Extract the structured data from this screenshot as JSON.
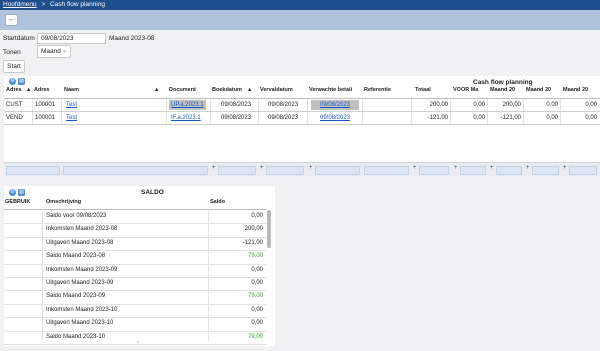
{
  "breadcrumb": {
    "home": "Hoofdmenu",
    "separator": ">",
    "current": "Cash flow planning"
  },
  "icons": {
    "back": "back-arrow-icon",
    "settings": "gear-icon",
    "export": "export-icon",
    "sort": "sort-arrow-icon"
  },
  "form": {
    "start_label": "Startdatum",
    "start_value": "09/08/2023",
    "period_text": "Maand 2023-08",
    "show_label": "Tonen",
    "show_value": "Maand",
    "start_button": "Start"
  },
  "cashflow": {
    "title": "Cash flow planning",
    "columns": [
      "Adres",
      "Adres",
      "Naam",
      "Document",
      "Boekdatum",
      "Vervaldatum",
      "Verwachte betali",
      "Referentie",
      "Totaal",
      "VOOR Ma",
      "Maand 20",
      "Maand 20",
      "Maand 20"
    ],
    "rows": [
      {
        "type": "CUST",
        "adres": "100001",
        "naam": "Test",
        "document": "UP.a.2023.1",
        "boekdatum": "09/08/2023",
        "vervaldatum": "09/08/2023",
        "verwacht": "09/08/2023",
        "referentie": "",
        "totaal": "200,00",
        "voor": "0,00",
        "m1": "200,00",
        "m2": "0,00",
        "m3": "0,00"
      },
      {
        "type": "VEND",
        "adres": "100001",
        "naam": "Test",
        "document": "IF.a.2023.1",
        "boekdatum": "09/08/2023",
        "vervaldatum": "09/08/2023",
        "verwacht": "09/08/2023",
        "referentie": "",
        "totaal": "-121,00",
        "voor": "0,00",
        "m1": "-121,00",
        "m2": "0,00",
        "m3": "0,00"
      }
    ]
  },
  "saldo": {
    "title": "SALDO",
    "columns": {
      "gebruik": "GEBRUIK",
      "omschrijving": "Omschrijving",
      "saldo": "Saldo"
    },
    "rows": [
      {
        "omschrijving": "Saldo voor 09/08/2023",
        "saldo": "0,00",
        "green": false
      },
      {
        "omschrijving": "Inkomsten Maand 2023-08",
        "saldo": "200,00",
        "green": false
      },
      {
        "omschrijving": "Uitgaven Maand 2023-08",
        "saldo": "-121,00",
        "green": false
      },
      {
        "omschrijving": "Saldo Maand 2023-08",
        "saldo": "79,00",
        "green": true
      },
      {
        "omschrijving": "Inkomsten Maand 2023-09",
        "saldo": "0,00",
        "green": false
      },
      {
        "omschrijving": "Uitgaven Maand 2023-09",
        "saldo": "0,00",
        "green": false
      },
      {
        "omschrijving": "Saldo Maand 2023-09",
        "saldo": "79,00",
        "green": true
      },
      {
        "omschrijving": "Inkomsten Maand 2023-10",
        "saldo": "0,00",
        "green": false
      },
      {
        "omschrijving": "Uitgaven Maand 2023-10",
        "saldo": "0,00",
        "green": false
      },
      {
        "omschrijving": "Saldo Maand 2023-10",
        "saldo": "79,00",
        "green": true
      }
    ]
  }
}
